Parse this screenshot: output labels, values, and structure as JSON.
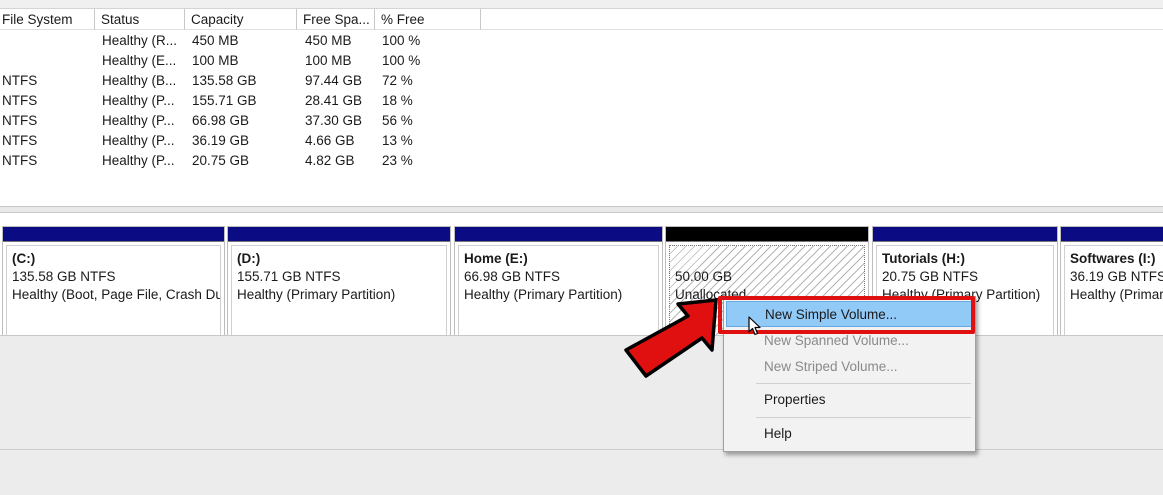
{
  "list": {
    "columns": [
      "File System",
      "Status",
      "Capacity",
      "Free Spa...",
      "% Free"
    ],
    "rows": [
      {
        "fs": "",
        "status": "Healthy (R...",
        "capacity": "450 MB",
        "free": "450 MB",
        "pct": "100 %"
      },
      {
        "fs": "",
        "status": "Healthy (E...",
        "capacity": "100 MB",
        "free": "100 MB",
        "pct": "100 %"
      },
      {
        "fs": "NTFS",
        "status": "Healthy (B...",
        "capacity": "135.58 GB",
        "free": "97.44 GB",
        "pct": "72 %"
      },
      {
        "fs": "NTFS",
        "status": "Healthy (P...",
        "capacity": "155.71 GB",
        "free": "28.41 GB",
        "pct": "18 %"
      },
      {
        "fs": "NTFS",
        "status": "Healthy (P...",
        "capacity": "66.98 GB",
        "free": "37.30 GB",
        "pct": "56 %"
      },
      {
        "fs": "NTFS",
        "status": "Healthy (P...",
        "capacity": "36.19 GB",
        "free": "4.66 GB",
        "pct": "13 %"
      },
      {
        "fs": "NTFS",
        "status": "Healthy (P...",
        "capacity": "20.75 GB",
        "free": "4.82 GB",
        "pct": "23 %"
      }
    ]
  },
  "partitions": [
    {
      "name": "(C:)",
      "size": "135.58 GB NTFS",
      "status": "Healthy (Boot, Page File, Crash Du"
    },
    {
      "name": "(D:)",
      "size": "155.71 GB NTFS",
      "status": "Healthy (Primary Partition)"
    },
    {
      "name": "Home  (E:)",
      "size": "66.98 GB NTFS",
      "status": "Healthy (Primary Partition)"
    },
    {
      "name": "",
      "size": "50.00 GB",
      "status": "Unallocated"
    },
    {
      "name": "Tutorials  (H:)",
      "size": "20.75 GB NTFS",
      "status": "Healthy (Primary Partition)"
    },
    {
      "name": "Softwares  (I:)",
      "size": "36.19 GB NTFS",
      "status": "Healthy (Primar"
    }
  ],
  "context_menu": {
    "new_simple_volume": "New Simple Volume...",
    "new_spanned_volume": "New Spanned Volume...",
    "new_striped_volume": "New Striped Volume...",
    "properties": "Properties",
    "help": "Help"
  },
  "colors": {
    "partition_bar": "#0b0b84",
    "unallocated_bar": "#000000",
    "menu_selected": "#91c9f7",
    "annotation_red": "#e01010"
  },
  "icons": {
    "cursor": "mouse-pointer-icon",
    "annotation": "red-arrow-icon"
  }
}
